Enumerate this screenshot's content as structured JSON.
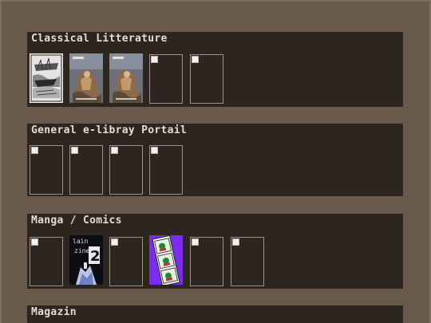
{
  "sections": [
    {
      "title": "Classical Litterature",
      "items": [
        {
          "kind": "engraving",
          "label": "ship-engraving-cover"
        },
        {
          "kind": "painting",
          "label": "painting-cover-1",
          "caption": "Liste"
        },
        {
          "kind": "painting",
          "label": "painting-cover-2",
          "caption": "Liste"
        },
        {
          "kind": "broken",
          "label": "broken-image"
        },
        {
          "kind": "broken",
          "label": "broken-image"
        }
      ]
    },
    {
      "title": "General e-libray Portail",
      "items": [
        {
          "kind": "broken"
        },
        {
          "kind": "broken"
        },
        {
          "kind": "broken"
        },
        {
          "kind": "broken"
        }
      ]
    },
    {
      "title": "Manga / Comics",
      "items": [
        {
          "kind": "broken"
        },
        {
          "kind": "zine",
          "line1": "lain",
          "line2": "zine",
          "number": "2"
        },
        {
          "kind": "broken"
        },
        {
          "kind": "comic-strip"
        },
        {
          "kind": "broken"
        },
        {
          "kind": "broken"
        }
      ]
    },
    {
      "title": "Magazin",
      "items": []
    }
  ]
}
